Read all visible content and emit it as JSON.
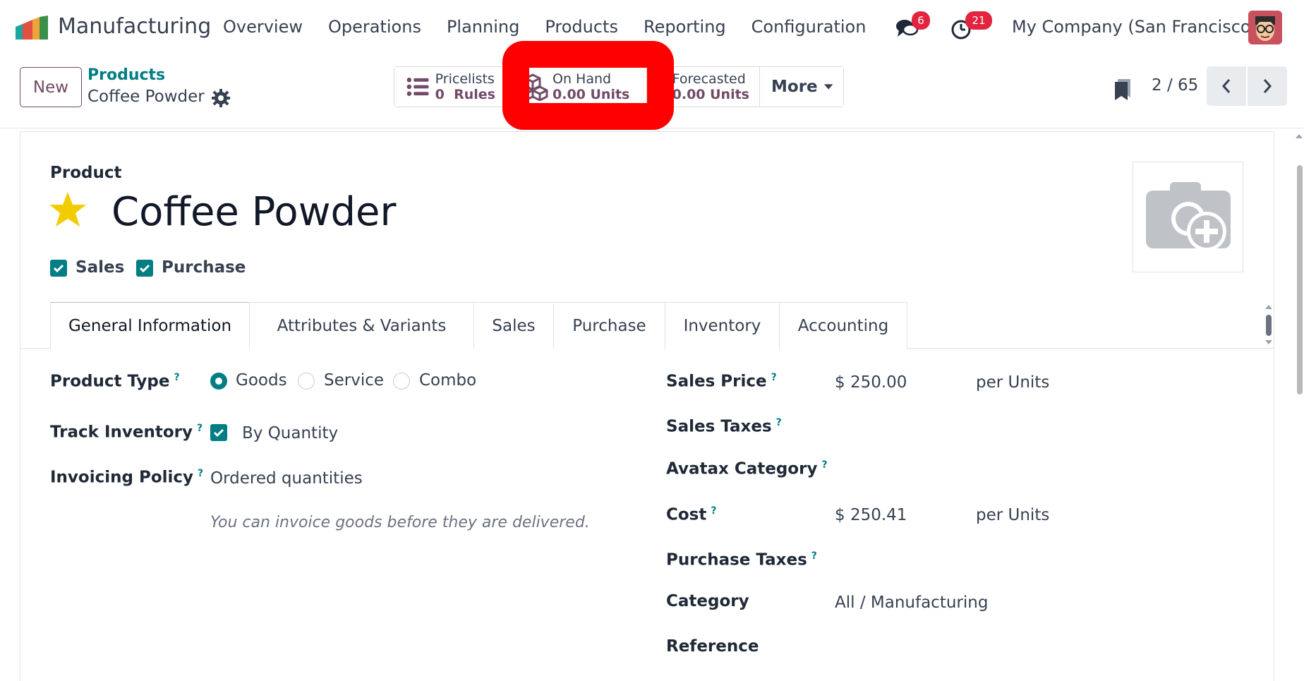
{
  "app": {
    "name": "Manufacturing",
    "menu": [
      "Overview",
      "Operations",
      "Planning",
      "Products",
      "Reporting",
      "Configuration"
    ],
    "messages_badge": "6",
    "activities_badge": "21",
    "company": "My Company (San Francisco)"
  },
  "control": {
    "new_label": "New",
    "breadcrumb_parent": "Products",
    "breadcrumb_current": "Coffee Powder",
    "smart_buttons": {
      "pricelists": {
        "label": "Pricelists",
        "value": "0  Rules"
      },
      "onhand": {
        "label": "On Hand",
        "value": "0.00 Units"
      },
      "forecasted": {
        "label": "Forecasted",
        "value": "0.00 Units"
      },
      "more": "More"
    },
    "pager": "2 / 65"
  },
  "product": {
    "label": "Product",
    "name": "Coffee Powder",
    "sales_label": "Sales",
    "purchase_label": "Purchase"
  },
  "tabs": [
    "General Information",
    "Attributes & Variants",
    "Sales",
    "Purchase",
    "Inventory",
    "Accounting"
  ],
  "general": {
    "product_type_label": "Product Type",
    "product_type_options": [
      "Goods",
      "Service",
      "Combo"
    ],
    "product_type_selected": "Goods",
    "track_inventory_label": "Track Inventory",
    "track_inventory_value": "By Quantity",
    "invoicing_policy_label": "Invoicing Policy",
    "invoicing_policy_value": "Ordered quantities",
    "invoicing_hint": "You can invoice goods before they are delivered.",
    "sales_price_label": "Sales Price",
    "sales_price_value": "$ 250.00",
    "sales_price_unit": "per Units",
    "sales_taxes_label": "Sales Taxes",
    "avatax_label": "Avatax Category",
    "cost_label": "Cost",
    "cost_value": "$ 250.41",
    "cost_unit": "per Units",
    "purchase_taxes_label": "Purchase Taxes",
    "category_label": "Category",
    "category_value": "All / Manufacturing",
    "reference_label": "Reference",
    "help_mark": "?"
  },
  "colors": {
    "brand": "#714b67",
    "accent": "#017e84",
    "badge": "#e3243f",
    "highlight": "#ff0000"
  }
}
